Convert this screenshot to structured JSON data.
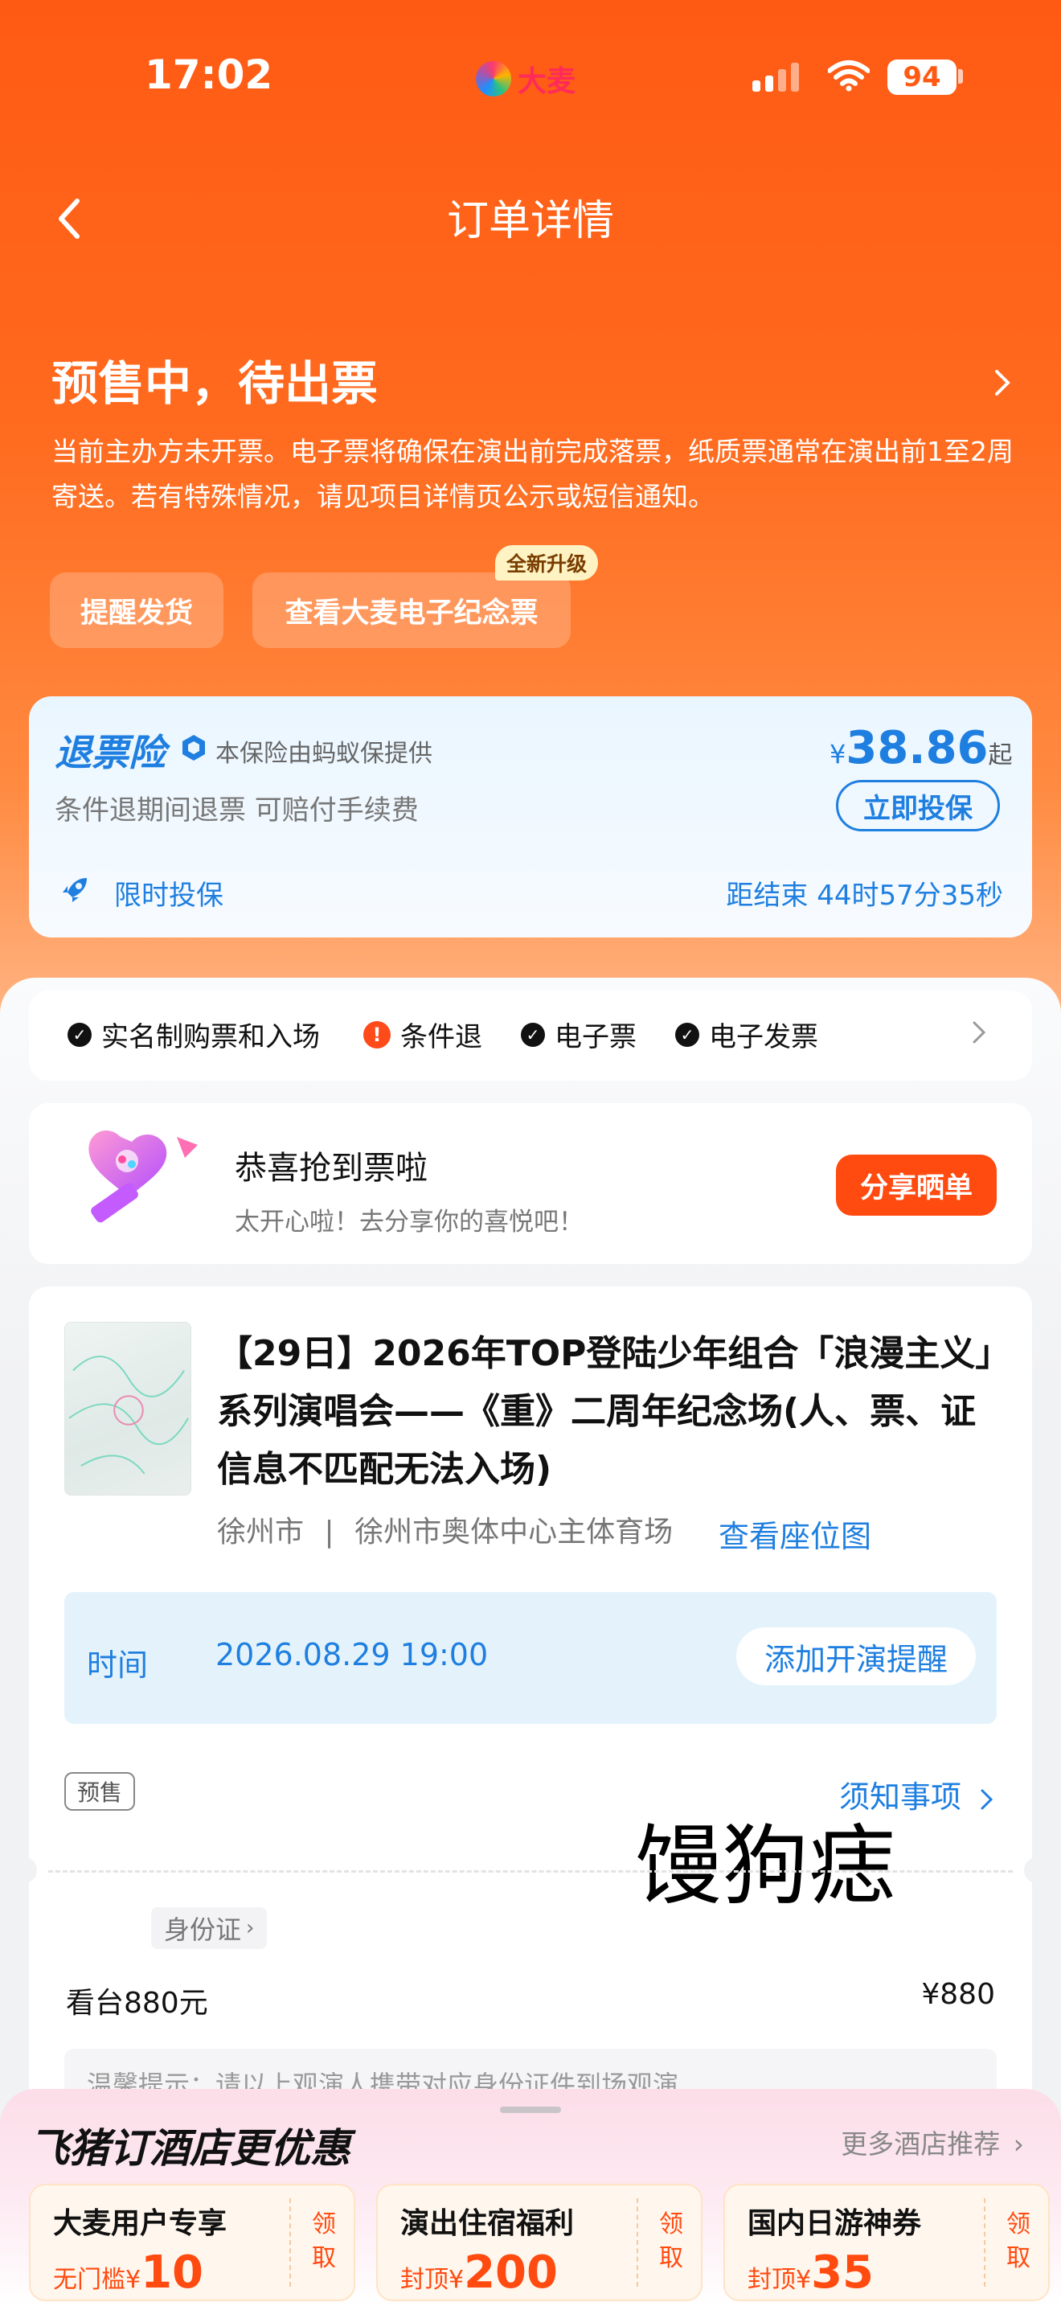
{
  "status_bar": {
    "time": "17:02",
    "app_badge": "大麦",
    "battery": "94"
  },
  "nav": {
    "title": "订单详情"
  },
  "order_status": {
    "title": "预售中，待出票",
    "description": "当前主办方未开票。电子票将确保在演出前完成落票，纸质票通常在演出前1至2周寄送。若有特殊情况，请见项目详情页公示或短信通知。",
    "buttons": {
      "remind_ship": "提醒发货",
      "view_souvenir": "查看大麦电子纪念票"
    },
    "upgrade_tag": "全新升级"
  },
  "insurance": {
    "title": "退票险",
    "provider": "本保险由蚂蚁保提供",
    "price_symbol": "¥",
    "price": "38.86",
    "price_suffix": "起",
    "subtitle": "条件退期间退票 可赔付手续费",
    "cta": "立即投保",
    "limited_label": "限时投保",
    "countdown": "距结束 44时57分35秒"
  },
  "tags": [
    "实名制购票和入场",
    "条件退",
    "电子票",
    "电子发票"
  ],
  "congrats": {
    "title": "恭喜抢到票啦",
    "subtitle": "太开心啦！去分享你的喜悦吧！",
    "share": "分享晒单"
  },
  "event": {
    "title": "【29日】2026年TOP登陆少年组合「浪漫主义」系列演唱会——《重》二周年纪念场(人、票、证信息不匹配无法入场)",
    "city": "徐州市",
    "separator": "|",
    "venue": "徐州市奥体中心主体育场",
    "seat_map": "查看座位图",
    "time_label": "时间",
    "time_value": "2026.08.29 19:00",
    "remind": "添加开演提醒",
    "presale_tag": "预售",
    "notice": "须知事项",
    "overlay_text": "馒狗痣",
    "id_chip": "身份证",
    "ticket_type": "看台880元",
    "ticket_price": "¥880",
    "tip": "温馨提示：请以上观演人携带对应身份证件到场观演"
  },
  "hotel": {
    "title": "飞猪订酒店更优惠",
    "more": "更多酒店推荐",
    "coupons": [
      {
        "title": "大麦用户专享",
        "cond": "无门槛¥",
        "amount": "10",
        "get": "领取"
      },
      {
        "title": "演出住宿福利",
        "cond": "封顶¥",
        "amount": "200",
        "get": "领取"
      },
      {
        "title": "国内日游神券",
        "cond": "封顶¥",
        "amount": "35",
        "get": "领取"
      }
    ]
  },
  "colors": {
    "brand_orange": "#ff5a14",
    "link_blue": "#1f7fe0",
    "cta_orange": "#ff4a10"
  }
}
